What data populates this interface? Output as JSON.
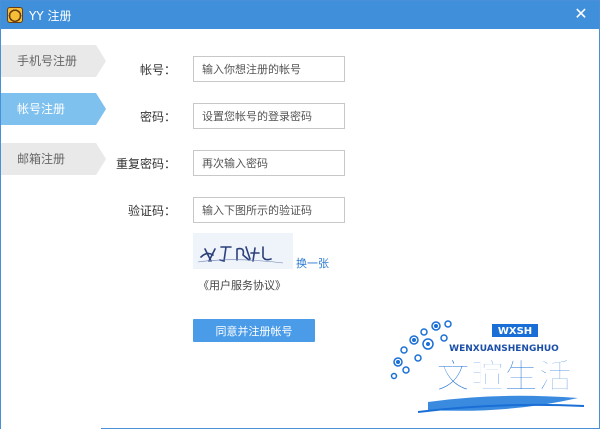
{
  "window": {
    "title": "YY 注册"
  },
  "sidebar": {
    "tabs": [
      {
        "label": "手机号注册",
        "active": false
      },
      {
        "label": "帐号注册",
        "active": true
      },
      {
        "label": "邮箱注册",
        "active": false
      }
    ]
  },
  "form": {
    "account": {
      "label": "帐号：",
      "placeholder": "输入你想注册的帐号"
    },
    "password": {
      "label": "密码：",
      "placeholder": "设置您帐号的登录密码"
    },
    "confirm": {
      "label": "重复密码：",
      "placeholder": "再次输入密码"
    },
    "captcha": {
      "label": "验证码：",
      "placeholder": "输入下图所示的验证码",
      "refresh_label": "换一张"
    },
    "agreement_label": "《用户服务协议》",
    "submit_label": "同意并注册帐号"
  },
  "watermark": {
    "brand_text": "文暄生活",
    "pinyin": "WENXUANSHENGHUO",
    "monogram": "WXSH"
  },
  "colors": {
    "titlebar": "#3f8fdb",
    "active_tab": "#7ec0ee",
    "button": "#4a9be8",
    "link": "#2a7ad2"
  }
}
